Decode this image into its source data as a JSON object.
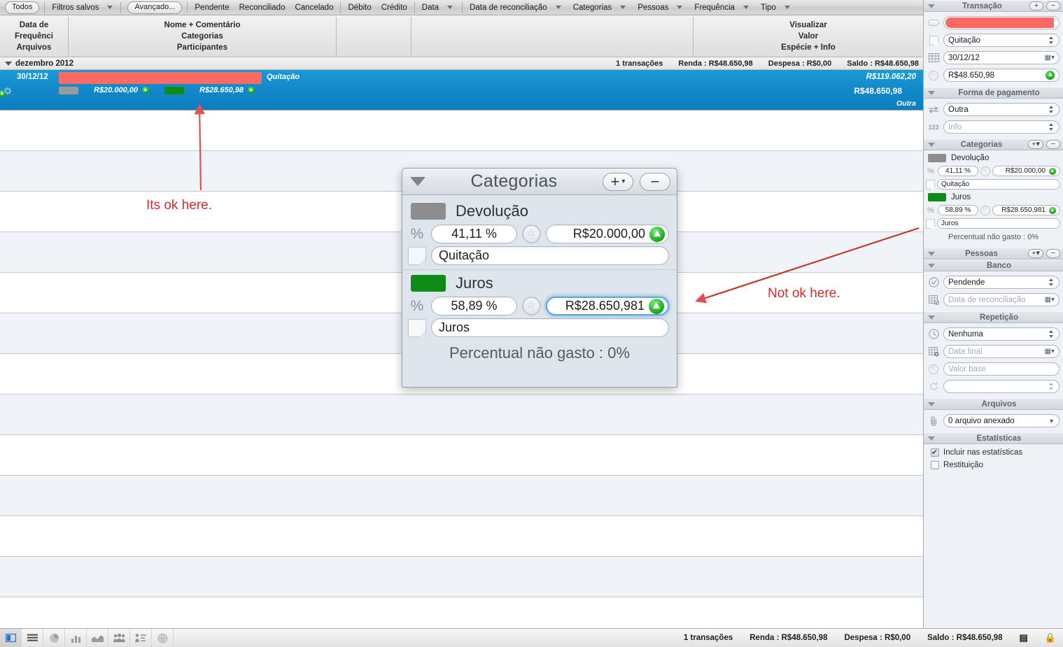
{
  "toolbar": {
    "all_button": "Todos",
    "saved_filters": "Filtros salvos",
    "advanced_button": "Avançado...",
    "items": [
      "Pendente",
      "Reconciliado",
      "Cancelado"
    ],
    "type_items": [
      "Débito",
      "Crédito"
    ],
    "menus": [
      "Data",
      "Data de reconciliação",
      "Categorias",
      "Pessoas",
      "Frequência",
      "Tipo"
    ]
  },
  "columns": {
    "left": [
      "Data de",
      "Frequênci",
      "Arquivos"
    ],
    "middle": [
      "Nome + Comentário",
      "Categorias",
      "Participantes"
    ],
    "right": [
      "Visualizar",
      "Valor",
      "Espécie + Info"
    ]
  },
  "month_group": {
    "label": "dezembro 2012",
    "transactions": "1 transações",
    "income": "Renda : R$48.650,98",
    "expense": "Despesa : R$0,00",
    "balance": "Saldo : R$48.650,98"
  },
  "transaction_row": {
    "date": "30/12/12",
    "name": "Quitação",
    "running_balance": "R$119.062,20",
    "amount": "R$48.650,98",
    "kind": "Outra",
    "categories": [
      {
        "color": "#9b9b9b",
        "amount": "R$20.000,00"
      },
      {
        "color": "#0f8c18",
        "amount": "R$28.650,98"
      }
    ]
  },
  "popup": {
    "title": "Categorias",
    "add_label": "+",
    "remove_label": "−",
    "categories": [
      {
        "color": "#8d8d8d",
        "name": "Devolução",
        "percent": "41,11 %",
        "amount": "R$20.000,00",
        "note": "Quitação",
        "focused": false
      },
      {
        "color": "#0f8c18",
        "name": "Juros",
        "percent": "58,89 %",
        "amount": "R$28.650,981",
        "note": "Juros",
        "focused": true
      }
    ],
    "footer": "Percentual não gasto : 0%"
  },
  "annotations": {
    "ok": "Its ok here.",
    "not_ok": "Not ok here.",
    "color": "#d52b2b"
  },
  "sidebar": {
    "transaction": {
      "title": "Transação",
      "add_label": "+",
      "remove_label": "−",
      "color_value": "#fa6a62",
      "name": "Quitação",
      "date": "30/12/12",
      "amount": "R$48.650,98"
    },
    "payment": {
      "title": "Forma de pagamento",
      "method": "Outra",
      "info_placeholder": "Info"
    },
    "categories": {
      "title": "Categorias",
      "add_label": "+",
      "remove_label": "−",
      "items": [
        {
          "color": "#8d8d8d",
          "name": "Devolução",
          "percent": "41,11 %",
          "amount": "R$20.000,00",
          "note": "Quitação"
        },
        {
          "color": "#0f8c18",
          "name": "Juros",
          "percent": "58,89 %",
          "amount": "R$28.650,981",
          "note": "Juros"
        }
      ],
      "footer": "Percentual não gasto : 0%"
    },
    "people": {
      "title": "Pessoas",
      "add_label": "+",
      "remove_label": "−"
    },
    "bank": {
      "title": "Banco",
      "status": "Pendende",
      "reconcile_date_placeholder": "Data de reconciliação"
    },
    "repetition": {
      "title": "Repetição",
      "frequency": "Nenhuma",
      "end_date_placeholder": "Data final",
      "base_value_placeholder": "Valor base",
      "extra_placeholder": ""
    },
    "files": {
      "title": "Arquivos",
      "attached": "0 arquivo anexado"
    },
    "statistics": {
      "title": "Estatísticas",
      "include_label": "Incluir nas estatísticas",
      "include_checked": true,
      "refund_label": "Restituição",
      "refund_checked": false
    }
  },
  "statusbar": {
    "icons": [
      "sidebar-icon",
      "list-icon",
      "pie-chart-icon",
      "bar-chart-icon",
      "area-chart-icon",
      "people-chart-icon",
      "ranking-chart-icon",
      "globe-icon"
    ],
    "transactions": "1 transações",
    "income": "Renda : R$48.650,98",
    "expense": "Despesa : R$0,00",
    "balance": "Saldo : R$48.650,98"
  }
}
